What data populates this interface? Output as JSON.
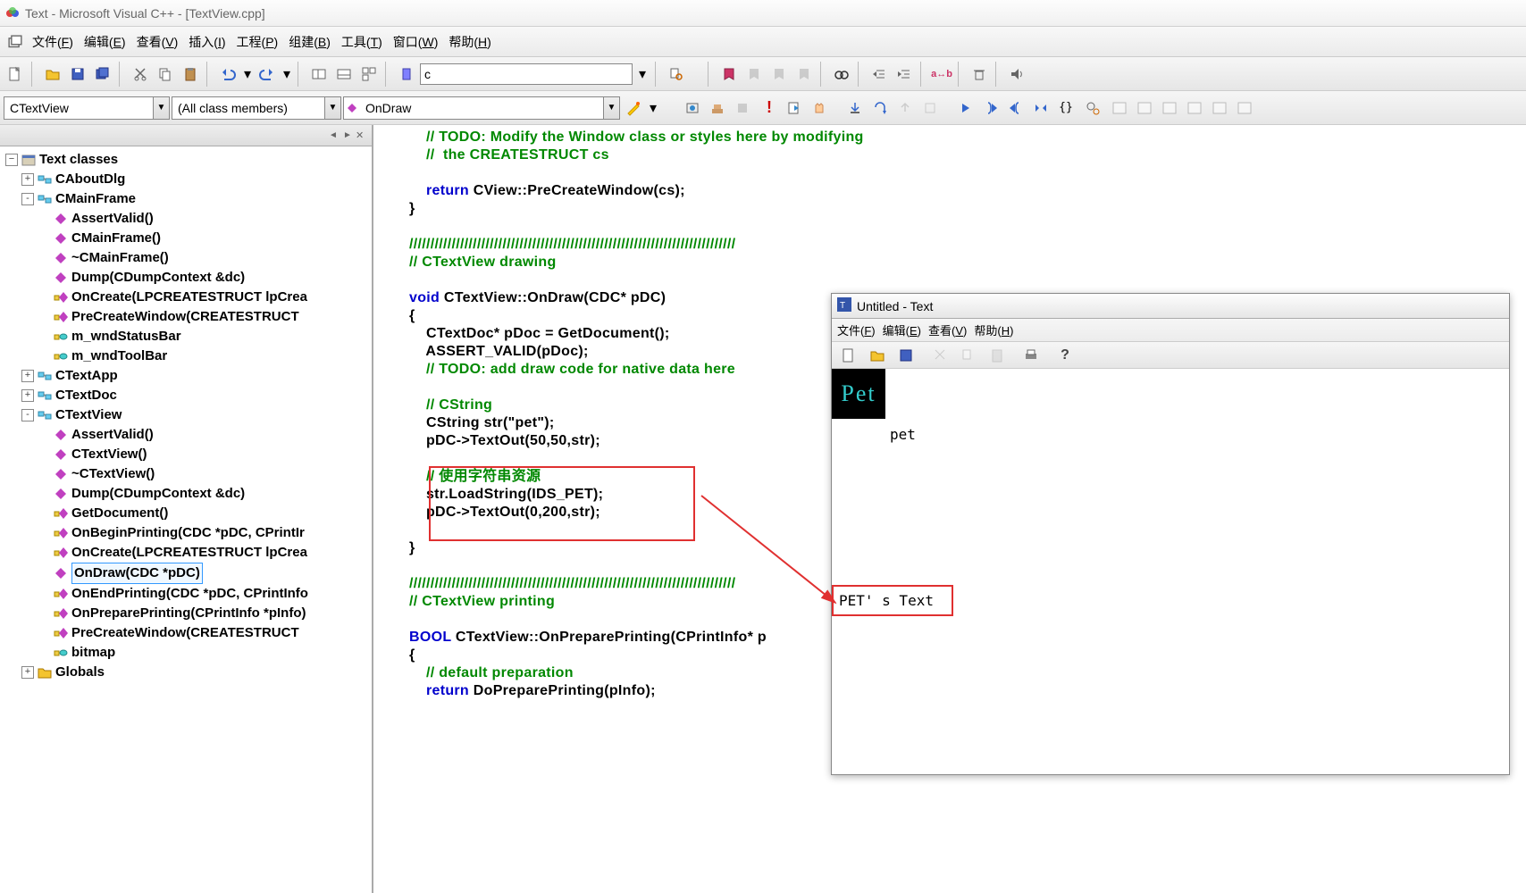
{
  "titlebar": {
    "title": "Text - Microsoft Visual C++ - [TextView.cpp]"
  },
  "menubar": {
    "items": [
      {
        "label": "文件",
        "key": "F"
      },
      {
        "label": "编辑",
        "key": "E"
      },
      {
        "label": "查看",
        "key": "V"
      },
      {
        "label": "插入",
        "key": "I"
      },
      {
        "label": "工程",
        "key": "P"
      },
      {
        "label": "组建",
        "key": "B"
      },
      {
        "label": "工具",
        "key": "T"
      },
      {
        "label": "窗口",
        "key": "W"
      },
      {
        "label": "帮助",
        "key": "H"
      }
    ]
  },
  "toolbar": {
    "search_value": "c"
  },
  "combos": {
    "class": "CTextView",
    "filter": "(All class members)",
    "member": "OnDraw"
  },
  "tree": {
    "root": "Text classes",
    "items": [
      {
        "type": "class",
        "exp": "+",
        "label": "CAboutDlg"
      },
      {
        "type": "class",
        "exp": "-",
        "label": "CMainFrame",
        "children": [
          {
            "type": "fn",
            "label": "AssertValid()"
          },
          {
            "type": "fn",
            "label": "CMainFrame()"
          },
          {
            "type": "fn",
            "label": "~CMainFrame()"
          },
          {
            "type": "fn",
            "label": "Dump(CDumpContext &dc)"
          },
          {
            "type": "fnprot",
            "label": "OnCreate(LPCREATESTRUCT lpCrea"
          },
          {
            "type": "fnprot",
            "label": "PreCreateWindow(CREATESTRUCT"
          },
          {
            "type": "varprot",
            "label": "m_wndStatusBar"
          },
          {
            "type": "varprot",
            "label": "m_wndToolBar"
          }
        ]
      },
      {
        "type": "class",
        "exp": "+",
        "label": "CTextApp"
      },
      {
        "type": "class",
        "exp": "+",
        "label": "CTextDoc"
      },
      {
        "type": "class",
        "exp": "-",
        "label": "CTextView",
        "children": [
          {
            "type": "fn",
            "label": "AssertValid()"
          },
          {
            "type": "fn",
            "label": "CTextView()"
          },
          {
            "type": "fn",
            "label": "~CTextView()"
          },
          {
            "type": "fn",
            "label": "Dump(CDumpContext &dc)"
          },
          {
            "type": "fnprot",
            "label": "GetDocument()"
          },
          {
            "type": "fnprot",
            "label": "OnBeginPrinting(CDC *pDC, CPrintIr"
          },
          {
            "type": "fnprot",
            "label": "OnCreate(LPCREATESTRUCT lpCrea"
          },
          {
            "type": "fn",
            "label": "OnDraw(CDC *pDC)",
            "selected": true
          },
          {
            "type": "fnprot",
            "label": "OnEndPrinting(CDC *pDC, CPrintInfo"
          },
          {
            "type": "fnprot",
            "label": "OnPreparePrinting(CPrintInfo *pInfo)"
          },
          {
            "type": "fnprot",
            "label": "PreCreateWindow(CREATESTRUCT"
          },
          {
            "type": "varprot",
            "label": "bitmap"
          }
        ]
      },
      {
        "type": "folder",
        "exp": "+",
        "label": "Globals"
      }
    ]
  },
  "code": {
    "l1": "    // TODO: Modify the Window class or styles here by modifying",
    "l2": "    //  the CREATESTRUCT cs",
    "l3": "",
    "l4a": "    ",
    "l4b": "return",
    "l4c": " CView::PreCreateWindow(cs);",
    "l5": "}",
    "l6": "",
    "l7": "/////////////////////////////////////////////////////////////////////////////",
    "l8": "// CTextView drawing",
    "l9": "",
    "l10a": "void",
    "l10b": " CTextView::OnDraw(CDC* pDC)",
    "l11": "{",
    "l12": "    CTextDoc* pDoc = GetDocument();",
    "l13": "    ASSERT_VALID(pDoc);",
    "l14": "    // TODO: add draw code for native data here",
    "l15": "",
    "l16": "    // CString",
    "l17": "    CString str(\"pet\");",
    "l18": "    pDC->TextOut(50,50,str);",
    "l19": "",
    "l20": "    // 使用字符串资源",
    "l21": "    str.LoadString(IDS_PET);",
    "l22": "    pDC->TextOut(0,200,str);",
    "l23": "",
    "l24": "}",
    "l25": "",
    "l26": "/////////////////////////////////////////////////////////////////////////////",
    "l27": "// CTextView printing",
    "l28": "",
    "l29a": "BOOL",
    "l29b": " CTextView::OnPreparePrinting(CPrintInfo* p",
    "l30": "{",
    "l31": "    // default preparation",
    "l32a": "    ",
    "l32b": "return",
    "l32c": " DoPreparePrinting(pInfo);",
    "l33": ""
  },
  "runtime": {
    "title": "Untitled - Text",
    "menu": [
      {
        "label": "文件",
        "key": "F"
      },
      {
        "label": "编辑",
        "key": "E"
      },
      {
        "label": "查看",
        "key": "V"
      },
      {
        "label": "帮助",
        "key": "H"
      }
    ],
    "logo_text": "Pet",
    "text1": "pet",
    "text2": "PET' s Text"
  }
}
